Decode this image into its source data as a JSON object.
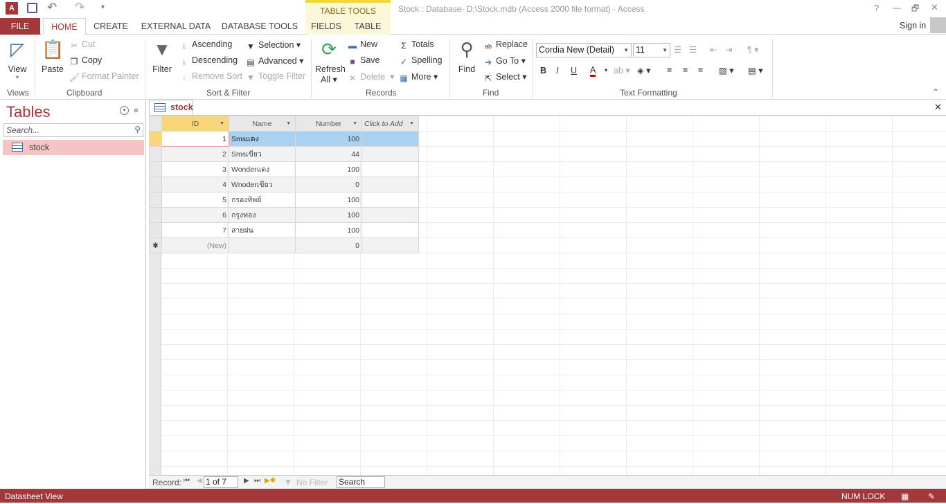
{
  "window": {
    "title": "Stock : Database- D:\\Stock.mdb (Access 2000 file format) - Access",
    "context_tab_group": "TABLE TOOLS",
    "help": "?",
    "minimize": "—",
    "restore": "🗗",
    "close": "✕",
    "sign_in": "Sign in"
  },
  "quick_access": {
    "app_icon": "A",
    "save": "save-icon",
    "undo": "↶",
    "redo": "↷",
    "customize": "▾"
  },
  "tabs": [
    "FILE",
    "HOME",
    "CREATE",
    "EXTERNAL DATA",
    "DATABASE TOOLS",
    "FIELDS",
    "TABLE"
  ],
  "ribbon": {
    "views": {
      "label": "Views",
      "view": "View"
    },
    "clipboard": {
      "label": "Clipboard",
      "paste": "Paste",
      "cut": "Cut",
      "copy": "Copy",
      "format_painter": "Format Painter"
    },
    "sort_filter": {
      "label": "Sort & Filter",
      "filter": "Filter",
      "ascending": "Ascending",
      "descending": "Descending",
      "remove_sort": "Remove Sort",
      "selection": "Selection",
      "advanced": "Advanced",
      "toggle_filter": "Toggle Filter"
    },
    "records": {
      "label": "Records",
      "refresh": "Refresh",
      "refresh_all": "All",
      "new": "New",
      "save": "Save",
      "delete": "Delete",
      "totals": "Totals",
      "spelling": "Spelling",
      "more": "More"
    },
    "find": {
      "label": "Find",
      "find": "Find",
      "replace": "Replace",
      "goto": "Go To",
      "select": "Select"
    },
    "text_formatting": {
      "label": "Text Formatting",
      "font": "Cordia New (Detail)",
      "size": "11",
      "bold": "B",
      "italic": "I",
      "underline": "U"
    }
  },
  "nav": {
    "title": "Tables",
    "search_placeholder": "Search...",
    "items": [
      {
        "label": "stock",
        "icon": "table-icon"
      }
    ]
  },
  "document": {
    "tab": "stock",
    "close": "✕"
  },
  "datasheet": {
    "columns": [
      "ID",
      "Name",
      "Number",
      "Click to Add"
    ],
    "rows": [
      {
        "id": "1",
        "name": "Smsแดง",
        "number": "100"
      },
      {
        "id": "2",
        "name": "Smsเขียว",
        "number": "44"
      },
      {
        "id": "3",
        "name": "Wonderแดง",
        "number": "100"
      },
      {
        "id": "4",
        "name": "Wnoderเขียว",
        "number": "0"
      },
      {
        "id": "5",
        "name": "กรองทิพย์",
        "number": "100"
      },
      {
        "id": "6",
        "name": "กรุงทอง",
        "number": "100"
      },
      {
        "id": "7",
        "name": "สายฝน",
        "number": "100"
      }
    ],
    "new_row": {
      "marker": "✱",
      "id": "(New)",
      "number": "0"
    }
  },
  "record_nav": {
    "label": "Record:",
    "position": "1 of 7",
    "filter": "No Filter",
    "search": "Search"
  },
  "status": {
    "view": "Datasheet View",
    "numlock": "NUM LOCK"
  },
  "colors": {
    "accent": "#a4373a",
    "selected_row": "#a9d1f2",
    "current_cell_header": "#f9d67a",
    "nav_selected": "#f5c4c4"
  }
}
